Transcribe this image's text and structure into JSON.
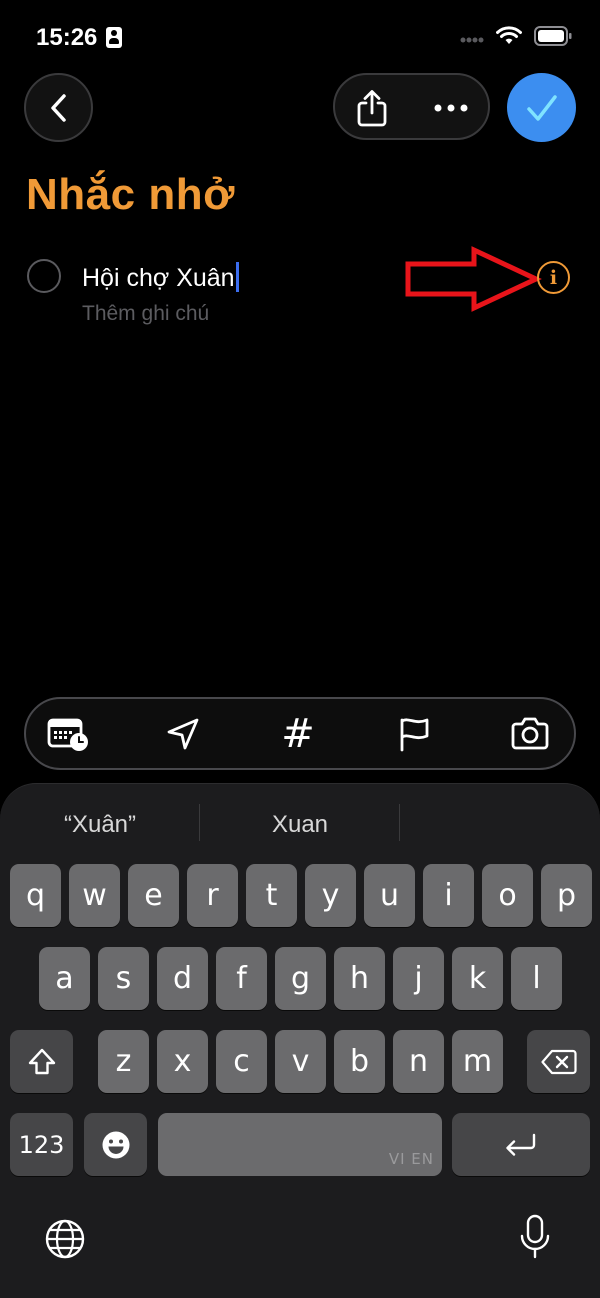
{
  "status": {
    "time": "15:26"
  },
  "nav": {
    "back_icon": "chevron-left-icon",
    "share_icon": "share-icon",
    "more_icon": "ellipsis-icon",
    "done_icon": "checkmark-icon"
  },
  "list": {
    "title": "Nhắc nhở"
  },
  "reminder": {
    "title": "Hội chợ Xuân",
    "notes_placeholder": "Thêm ghi chú",
    "info_glyph": "i"
  },
  "toolbar": {
    "items": [
      "calendar-clock-icon",
      "location-arrow-icon",
      "hashtag-icon",
      "flag-icon",
      "camera-icon"
    ],
    "hashtag_glyph": "#"
  },
  "keyboard": {
    "suggestions": [
      "“Xuân”",
      "Xuan",
      ""
    ],
    "row1": [
      "q",
      "w",
      "e",
      "r",
      "t",
      "y",
      "u",
      "i",
      "o",
      "p"
    ],
    "row2": [
      "a",
      "s",
      "d",
      "f",
      "g",
      "h",
      "j",
      "k",
      "l"
    ],
    "row3": [
      "z",
      "x",
      "c",
      "v",
      "b",
      "n",
      "m"
    ],
    "numbers_label": "123",
    "space_language_label": "VI EN"
  },
  "colors": {
    "accent": "#f09a37",
    "done": "#3c8ef0",
    "caret": "#3c6ef0",
    "annotation": "#e8141a"
  }
}
